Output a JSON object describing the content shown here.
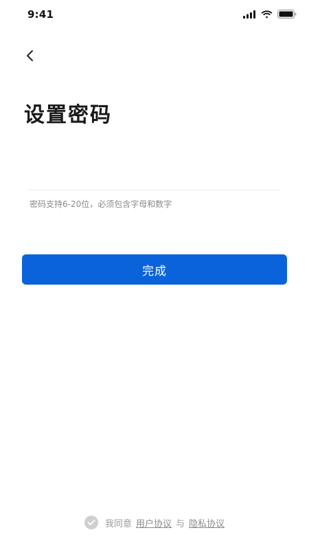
{
  "status_bar": {
    "time": "9:41"
  },
  "page": {
    "title": "设置密码"
  },
  "form": {
    "password_value": "",
    "password_placeholder": "",
    "hint": "密码支持6-20位，必须包含字母和数字"
  },
  "actions": {
    "submit_label": "完成"
  },
  "agreement": {
    "prefix": "我同意",
    "user_agreement": "用户协议",
    "conjunction": "与",
    "privacy_policy": "隐私协议"
  },
  "colors": {
    "primary": "#0b63dc",
    "checkbox_unchecked": "#cfcfcf"
  },
  "icons": {
    "back": "chevron-left-icon",
    "signal": "signal-icon",
    "wifi": "wifi-icon",
    "battery": "battery-icon",
    "checkbox": "check-circle-icon"
  }
}
